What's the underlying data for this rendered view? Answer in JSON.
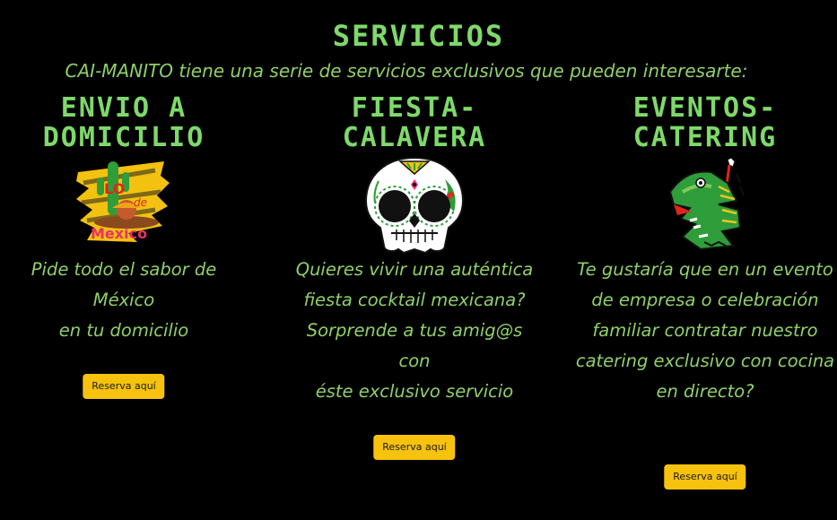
{
  "section": {
    "title": "SERVICIOS",
    "intro": "CAI-MANITO tiene una serie de servicios exclusivos que pueden interesarte:"
  },
  "services": [
    {
      "title_line1": "ENVIO A",
      "title_line2": "DOMICILIO",
      "image_icon": "lo-de-mexico-logo",
      "image_text_top": "LO",
      "image_text_mid": "de",
      "image_text_bottom": "Mexico",
      "text_lines": [
        "Pide todo el sabor de México",
        "en tu domicilio"
      ],
      "button_label": "Reserva aquí"
    },
    {
      "title_line1": "FIESTA-",
      "title_line2": "CALAVERA",
      "image_icon": "sugar-skull-icon",
      "text_lines": [
        "Quieres vivir una auténtica",
        "fiesta cocktail mexicana?",
        "Sorprende a tus amig@s con",
        "éste exclusivo servicio"
      ],
      "button_label": "Reserva aquí"
    },
    {
      "title_line1": "EVENTOS-",
      "title_line2": "CATERING",
      "image_icon": "aztec-serpent-icon",
      "text_lines": [
        "Te gustaría que en un evento",
        "de empresa o celebración",
        "familiar contratar nuestro",
        "catering exclusivo con cocina",
        "en directo?"
      ],
      "button_label": "Reserva aquí"
    }
  ],
  "colors": {
    "background": "#000000",
    "heading_green": "#7ed96a",
    "text_green": "#8fd06a",
    "button_yellow": "#f6c20e"
  }
}
